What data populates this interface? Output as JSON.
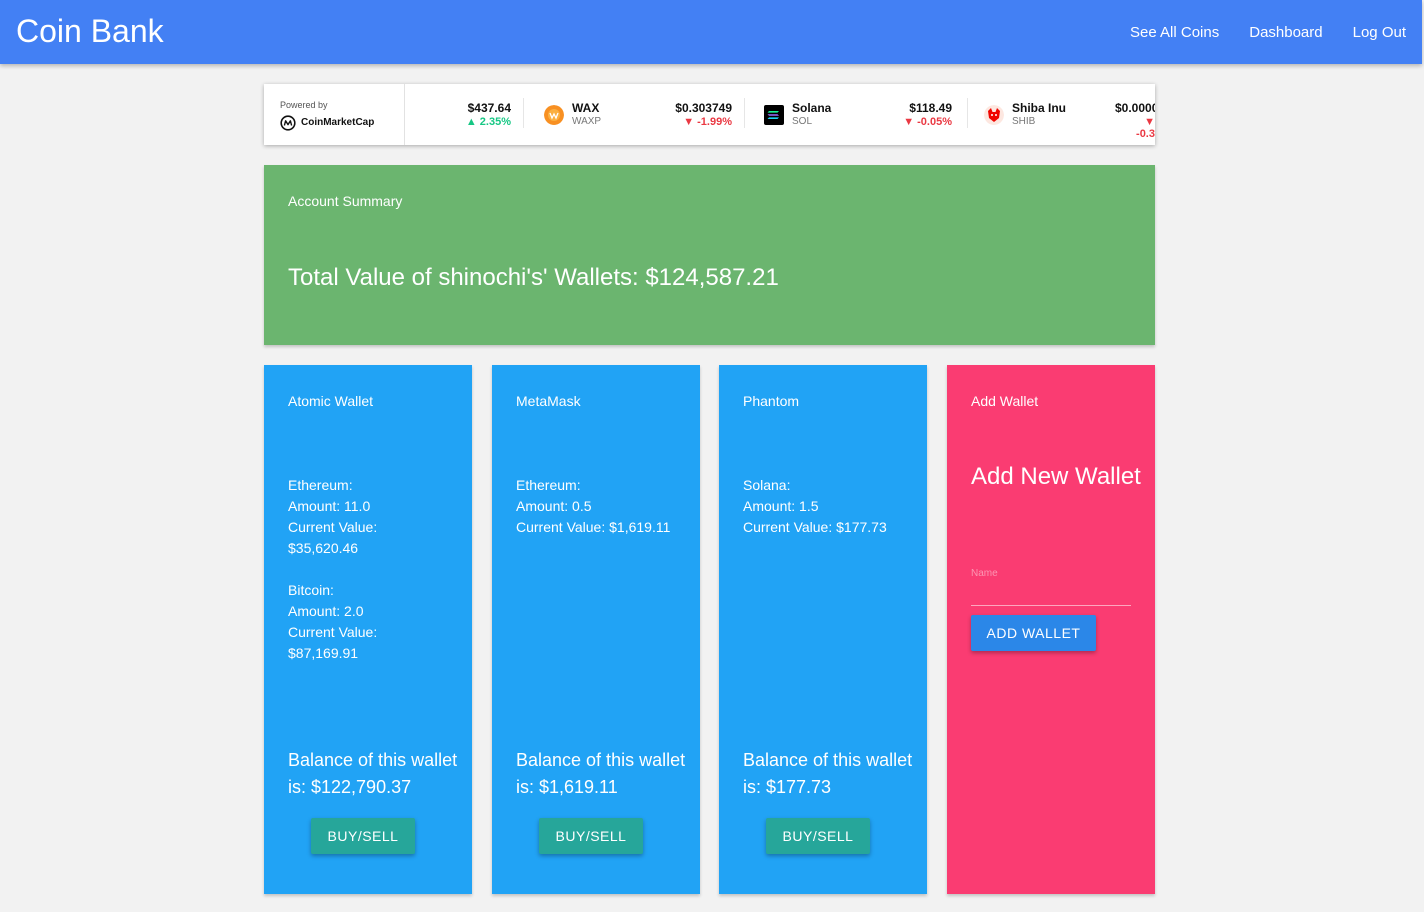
{
  "navbar": {
    "brand": "Coin Bank",
    "links": [
      "See All Coins",
      "Dashboard",
      "Log Out"
    ],
    "color": "#4380f4"
  },
  "ticker": {
    "powered_by": "Powered by",
    "provider": "CoinMarketCap",
    "coins": [
      {
        "name": "",
        "symbol": "",
        "price": "$437.64",
        "change": "2.35%",
        "direction": "up"
      },
      {
        "name": "WAX",
        "symbol": "WAXP",
        "price": "$0.303749",
        "change": "-1.99%",
        "direction": "down",
        "icon": "wax-icon",
        "icon_color": "#f89022"
      },
      {
        "name": "Solana",
        "symbol": "SOL",
        "price": "$118.49",
        "change": "-0.05%",
        "direction": "down",
        "icon": "solana-icon",
        "icon_color": "#000000"
      },
      {
        "name": "Shiba Inu",
        "symbol": "SHIB",
        "price": "$0.0000",
        "change": "-0.3",
        "direction": "down",
        "icon": "shiba-inu-icon",
        "icon_color": "#f00500"
      }
    ]
  },
  "summary": {
    "title": "Account Summary",
    "total": "Total Value of shinochi's' Wallets: $124,587.21",
    "color": "#6bb56f"
  },
  "wallets": [
    {
      "title": "Atomic Wallet",
      "holdings": [
        {
          "coin": "Ethereum:",
          "amount": "Amount: 11.0",
          "value_label": "Current Value:",
          "value": "$35,620.46"
        },
        {
          "coin": "Bitcoin:",
          "amount": "Amount: 2.0",
          "value_label": "Current Value:",
          "value": "$87,169.91"
        }
      ],
      "balance": "Balance of this wallet is: $122,790.37",
      "button": "BUY/SELL"
    },
    {
      "title": "MetaMask",
      "holdings": [
        {
          "coin": "Ethereum:",
          "amount": "Amount: 0.5",
          "value_label": "Current Value:",
          "value": "$1,619.11"
        }
      ],
      "balance": "Balance of this wallet is: $1,619.11",
      "button": "BUY/SELL"
    },
    {
      "title": "Phantom",
      "holdings": [
        {
          "coin": "Solana:",
          "amount": "Amount: 1.5",
          "value_label": "Current Value:",
          "value": "$177.73"
        }
      ],
      "balance": "Balance of this wallet is: $177.73",
      "button": "BUY/SELL"
    }
  ],
  "wallet_color": "#21a3f5",
  "add_wallet": {
    "title": "Add Wallet",
    "heading": "Add New Wallet",
    "name_placeholder": "Name",
    "name_value": "",
    "button": "ADD WALLET",
    "color": "#fa3c72"
  }
}
